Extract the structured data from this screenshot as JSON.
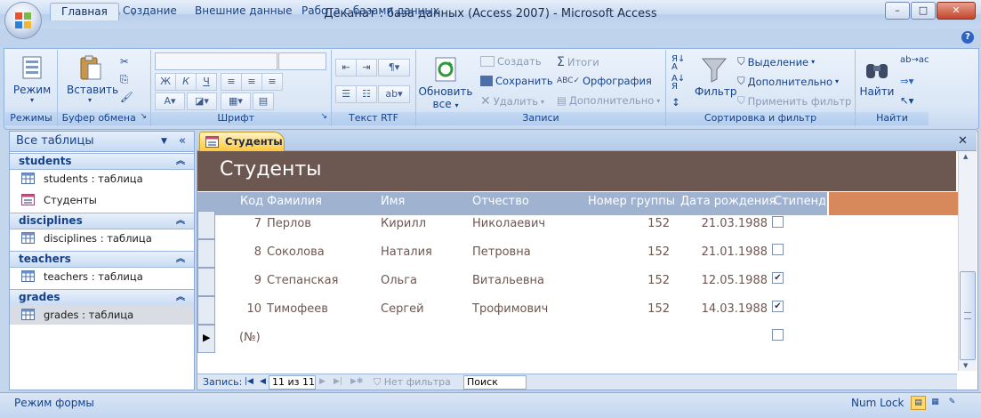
{
  "window": {
    "title": "Деканат : база данных (Access 2007)  -  Microsoft Access"
  },
  "ribbon_tabs": [
    "Главная",
    "Создание",
    "Внешние данные",
    "Работа с базами данных"
  ],
  "ribbon": {
    "groups": {
      "views": "Режимы",
      "clipboard": "Буфер обмена",
      "font": "Шрифт",
      "rtf": "Текст RTF",
      "records": "Записи",
      "sortfilter": "Сортировка и фильтр",
      "find": "Найти"
    },
    "view_btn": "Режим",
    "paste_btn": "Вставить",
    "refresh_btn_1": "Обновить",
    "refresh_btn_2": "все",
    "create": "Создать",
    "save": "Сохранить",
    "delete": "Удалить",
    "totals": "Итоги",
    "spelling": "Орфография",
    "more": "Дополнительно",
    "filter": "Фильтр",
    "selection": "Выделение",
    "advanced": "Дополнительно",
    "toggle_filter": "Применить фильтр",
    "find_btn": "Найти"
  },
  "nav": {
    "header": "Все таблицы",
    "groups": [
      {
        "name": "students",
        "items": [
          "students : таблица",
          "Студенты"
        ]
      },
      {
        "name": "disciplines",
        "items": [
          "disciplines : таблица"
        ]
      },
      {
        "name": "teachers",
        "items": [
          "teachers : таблица"
        ]
      },
      {
        "name": "grades",
        "items": [
          "grades : таблица"
        ]
      }
    ]
  },
  "doc_tab": "Студенты",
  "form": {
    "title": "Студенты",
    "columns": [
      "Код",
      "Фамилия",
      "Имя",
      "Отчество",
      "Номер группы",
      "Дата рождения",
      "Стипенд"
    ],
    "rows": [
      {
        "id": "7",
        "last": "Перлов",
        "first": "Кирилл",
        "middle": "Николаевич",
        "group": "152",
        "dob": "21.03.1988",
        "stipend": false
      },
      {
        "id": "8",
        "last": "Соколова",
        "first": "Наталия",
        "middle": "Петровна",
        "group": "152",
        "dob": "21.01.1988",
        "stipend": false
      },
      {
        "id": "9",
        "last": "Степанская",
        "first": "Ольга",
        "middle": "Витальевна",
        "group": "152",
        "dob": "12.05.1988",
        "stipend": true
      },
      {
        "id": "10",
        "last": "Тимофеев",
        "first": "Сергей",
        "middle": "Трофимович",
        "group": "152",
        "dob": "14.03.1988",
        "stipend": true
      }
    ],
    "new_row": "(№)"
  },
  "record_nav": {
    "label": "Запись:",
    "position": "11 из 11",
    "filter": "Нет фильтра",
    "search": "Поиск"
  },
  "status": {
    "mode": "Режим формы",
    "numlock": "Num Lock"
  },
  "colors": {
    "form_header": "#6d5751",
    "column_header": "#9fb3d1",
    "accent_orange": "#d7895b",
    "doc_tab": "#ffd871"
  }
}
